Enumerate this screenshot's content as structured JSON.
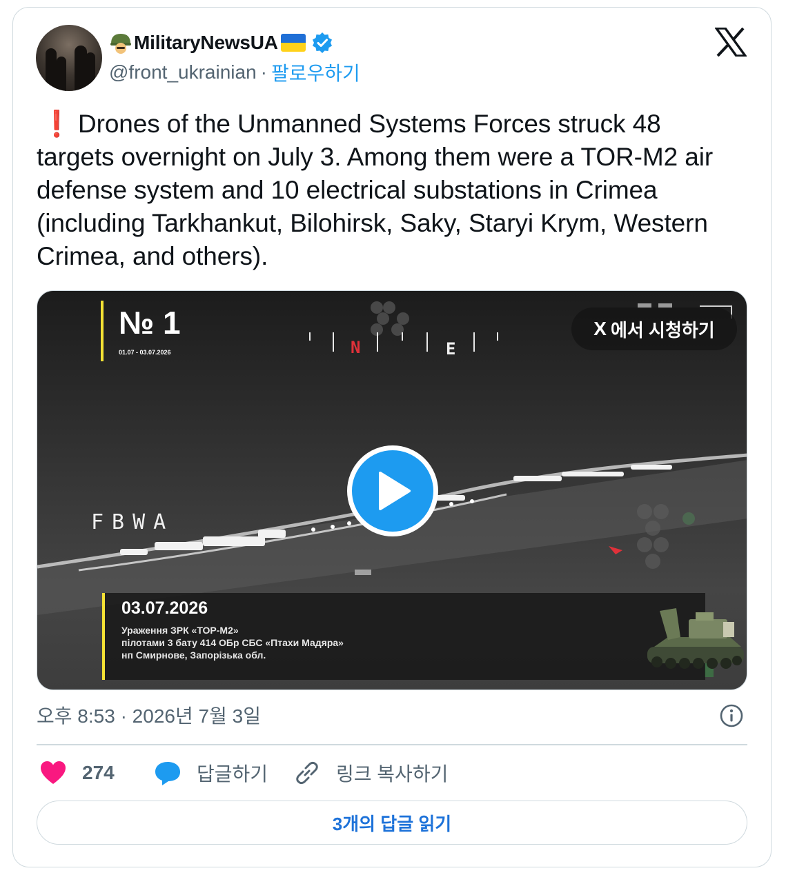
{
  "author": {
    "display_name": "MilitaryNewsUA",
    "handle": "@front_ukrainian",
    "separator": "·",
    "follow_label": "팔로우하기"
  },
  "tweet": {
    "emoji": "❗",
    "text": "Drones of the Unmanned Systems Forces struck 48 targets overnight on July 3. Among them were a TOR-M2 air defense system and 10 electrical substations in Crimea (including Tarkhankut, Bilohirsk, Saky, Staryi Krym, Western Crimea, and others)."
  },
  "media": {
    "badge_number": "№ 1",
    "badge_date": "01.07 - 03.07.2026",
    "compass_n": "N",
    "compass_e": "E",
    "watch_x": "X",
    "watch_label": "에서 시청하기",
    "overlay_code": "FBWA",
    "caption_date": "03.07.2026",
    "caption_line1": "Ураження ЗРК «ТОР-М2»",
    "caption_line2": "пілотами 3 бату 414 ОБр СБС «Птахи Мадяра»",
    "caption_line3": "нп Смирнове, Запорізька обл."
  },
  "meta": {
    "timestamp": "오후 8:53 · 2026년 7월 3일"
  },
  "actions": {
    "like_count": "274",
    "reply_label": "답글하기",
    "copy_link_label": "링크 복사하기"
  },
  "read_replies_label": "3개의 답글 읽기",
  "colors": {
    "accent": "#1d9bf0",
    "like": "#f91880",
    "text_secondary": "#536471",
    "caption_bar": "#f5e234"
  },
  "icons": [
    "helmet-emoji-icon",
    "ukraine-flag-icon",
    "verified-badge-icon",
    "x-logo-icon",
    "play-icon",
    "info-icon",
    "heart-icon",
    "reply-bubble-icon",
    "link-icon"
  ]
}
